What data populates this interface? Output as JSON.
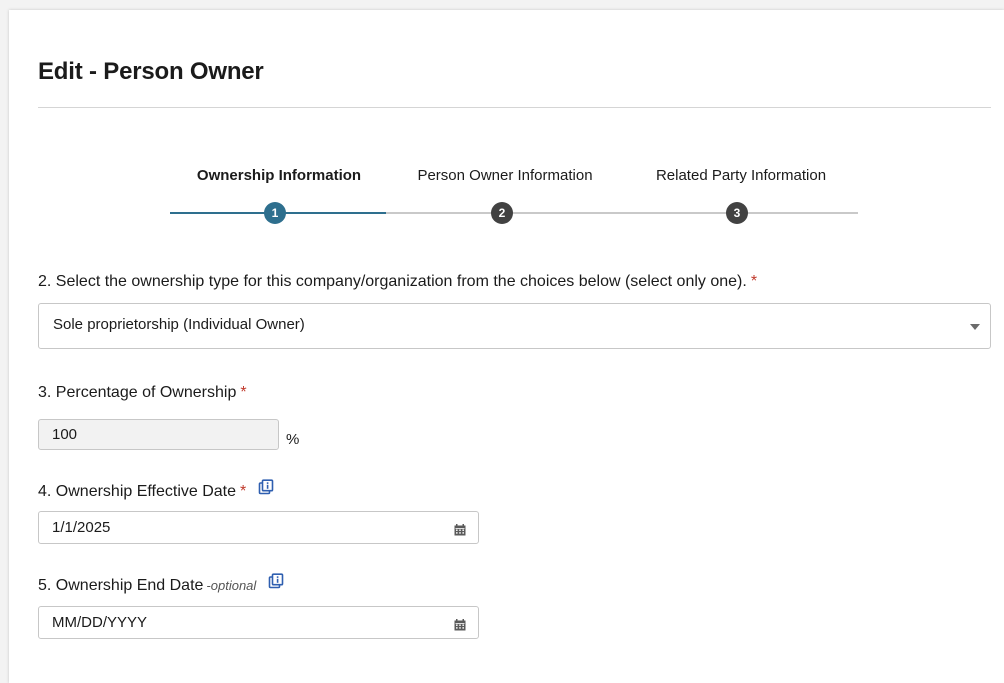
{
  "page": {
    "title": "Edit - Person Owner"
  },
  "stepper": {
    "steps": [
      {
        "label": "Ownership Information",
        "number": "1",
        "active": true
      },
      {
        "label": "Person Owner Information",
        "number": "2",
        "active": false
      },
      {
        "label": "Related Party Information",
        "number": "3",
        "active": false
      }
    ]
  },
  "form": {
    "ownership_type": {
      "label": "2. Select the ownership type for this company/organization from the choices below (select only one).",
      "required_marker": "*",
      "selected_value": "Sole proprietorship (Individual Owner)"
    },
    "percentage": {
      "label": "3. Percentage of Ownership",
      "required_marker": "*",
      "value": "100",
      "unit": "%"
    },
    "effective_date": {
      "label": "4. Ownership Effective Date",
      "required_marker": "*",
      "value": "1/1/2025",
      "icon": "info-copy-icon"
    },
    "end_date": {
      "label": "5. Ownership End Date",
      "optional_marker": "-optional",
      "placeholder": "MM/DD/YYYY",
      "icon": "info-copy-icon"
    }
  },
  "colors": {
    "accent": "#2e6f8e",
    "inactive_step": "#424242",
    "required": "#c0392b",
    "info_icon": "#2f5fb0"
  }
}
